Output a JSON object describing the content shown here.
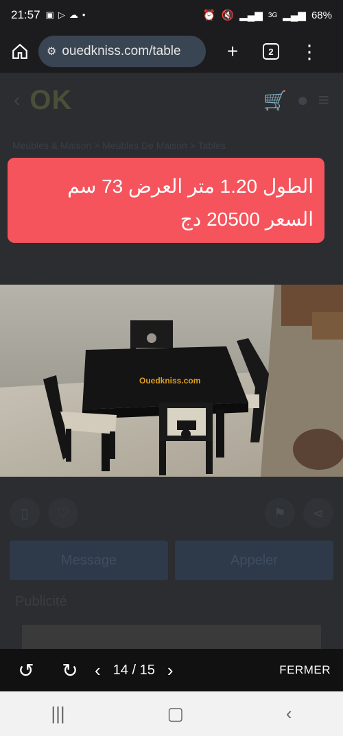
{
  "status_bar": {
    "time": "21:57",
    "battery": "68%",
    "network": "3G"
  },
  "browser": {
    "url": "ouedkniss.com/table",
    "tab_count": "2"
  },
  "site_background": {
    "breadcrumb": "Meubles & Maison  >  Meubles De Maison  >  Tables",
    "message_label": "Message",
    "call_label": "Appeler",
    "ad_label": "Publicité"
  },
  "overlay_text": {
    "line1": "الطول 1.20 متر العرض 73 سم",
    "line2": "السعر 20500 دج"
  },
  "photo": {
    "watermark": "Ouedkniss.com"
  },
  "viewer": {
    "counter": "14 / 15",
    "close_label": "FERMER"
  },
  "colors": {
    "overlay_red": "#f6545d",
    "url_bar": "#3a4553"
  }
}
